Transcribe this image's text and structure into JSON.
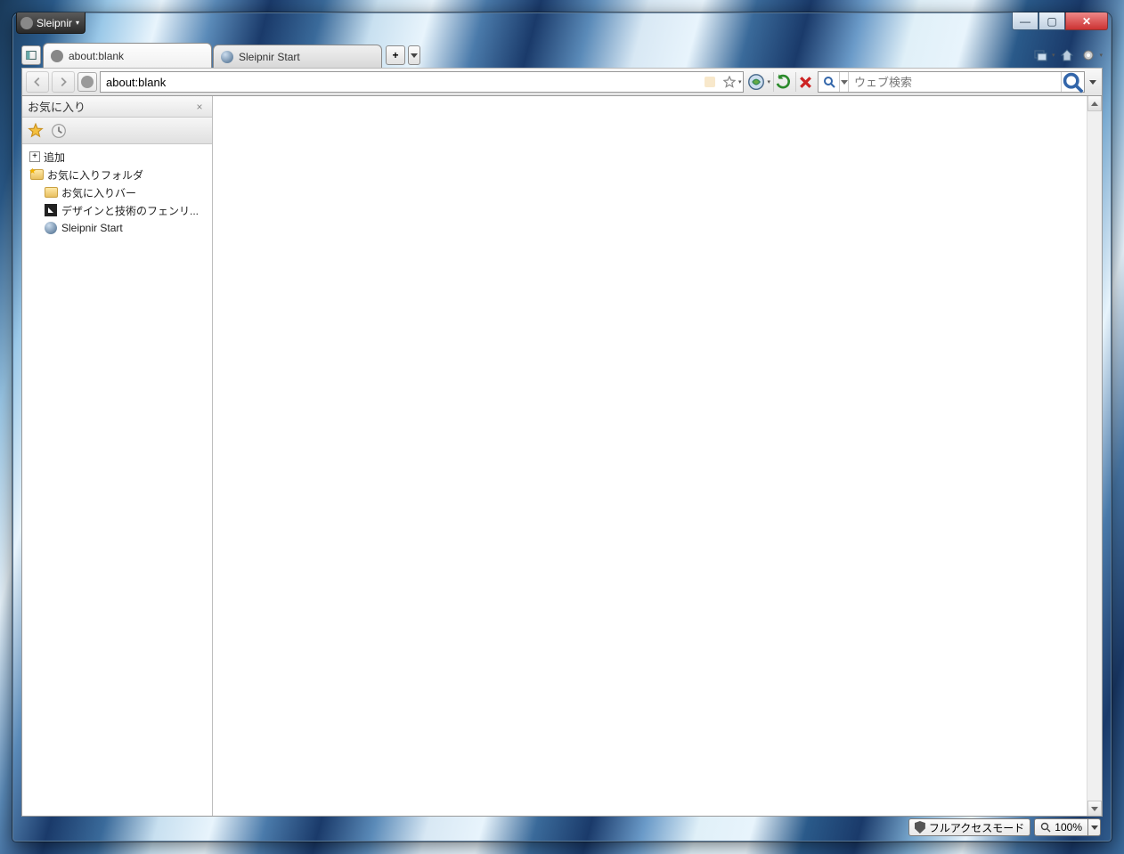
{
  "app": {
    "menu_label": "Sleipnir"
  },
  "tabs": [
    {
      "label": "about:blank",
      "active": true
    },
    {
      "label": "Sleipnir Start",
      "active": false
    }
  ],
  "toolbar": {
    "address_value": "about:blank",
    "search_placeholder": "ウェブ検索"
  },
  "sidebar": {
    "title": "お気に入り",
    "add_label": "追加",
    "folder_label": "お気に入りフォルダ",
    "items": [
      {
        "label": "お気に入りバー",
        "type": "folder"
      },
      {
        "label": "デザインと技術のフェンリ...",
        "type": "page"
      },
      {
        "label": "Sleipnir Start",
        "type": "globe"
      }
    ]
  },
  "status": {
    "mode_label": "フルアクセスモード",
    "zoom_label": "100%"
  }
}
